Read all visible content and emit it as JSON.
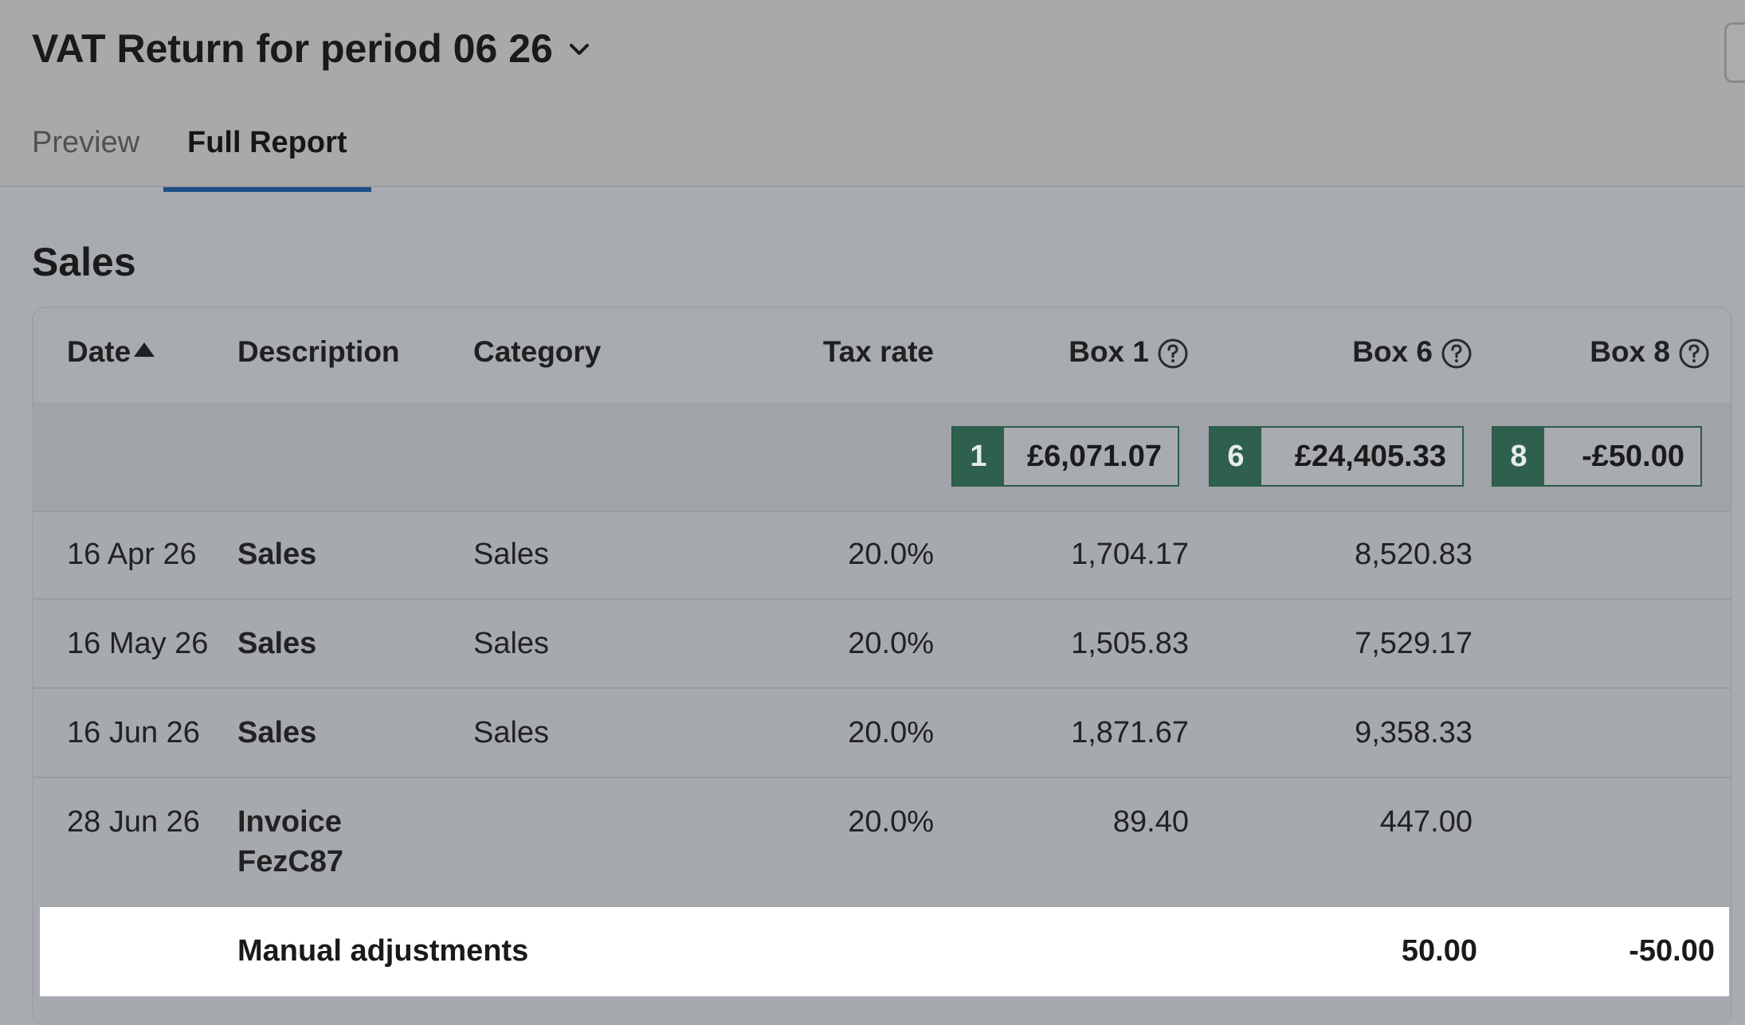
{
  "header": {
    "title": "VAT Return for period 06 26",
    "tabs": [
      {
        "label": "Preview",
        "active": false
      },
      {
        "label": "Full Report",
        "active": true
      }
    ]
  },
  "section": {
    "title": "Sales"
  },
  "table": {
    "columns": {
      "date": "Date",
      "description": "Description",
      "category": "Category",
      "tax_rate": "Tax rate",
      "box1": "Box 1",
      "box6": "Box 6",
      "box8": "Box 8"
    },
    "sort": {
      "column": "date",
      "direction": "ascending"
    },
    "totals": {
      "box1": {
        "badge": "1",
        "amount": "£6,071.07"
      },
      "box6": {
        "badge": "6",
        "amount": "£24,405.33"
      },
      "box8": {
        "badge": "8",
        "amount": "-£50.00"
      }
    },
    "rows": [
      {
        "date": "16 Apr 26",
        "description": "Sales",
        "category": "Sales",
        "tax_rate": "20.0%",
        "box1": "1,704.17",
        "box6": "8,520.83",
        "box8": ""
      },
      {
        "date": "16 May 26",
        "description": "Sales",
        "category": "Sales",
        "tax_rate": "20.0%",
        "box1": "1,505.83",
        "box6": "7,529.17",
        "box8": ""
      },
      {
        "date": "16 Jun 26",
        "description": "Sales",
        "category": "Sales",
        "tax_rate": "20.0%",
        "box1": "1,871.67",
        "box6": "9,358.33",
        "box8": ""
      },
      {
        "date": "28 Jun 26",
        "description": "Invoice FezC87",
        "category": "",
        "tax_rate": "20.0%",
        "box1": "89.40",
        "box6": "447.00",
        "box8": ""
      }
    ],
    "manual_adjustments": {
      "label": "Manual adjustments",
      "box6": "50.00",
      "box8": "-50.00"
    }
  },
  "colors": {
    "accent": "#1e4f86",
    "link": "#1f4f8a",
    "badge": "#2f5f4d",
    "overlay_background": "#a8abb0"
  },
  "icons": {
    "title_dropdown": "chevron-down-icon",
    "help": "help-circle-icon",
    "sort": "sort-ascending-icon"
  }
}
